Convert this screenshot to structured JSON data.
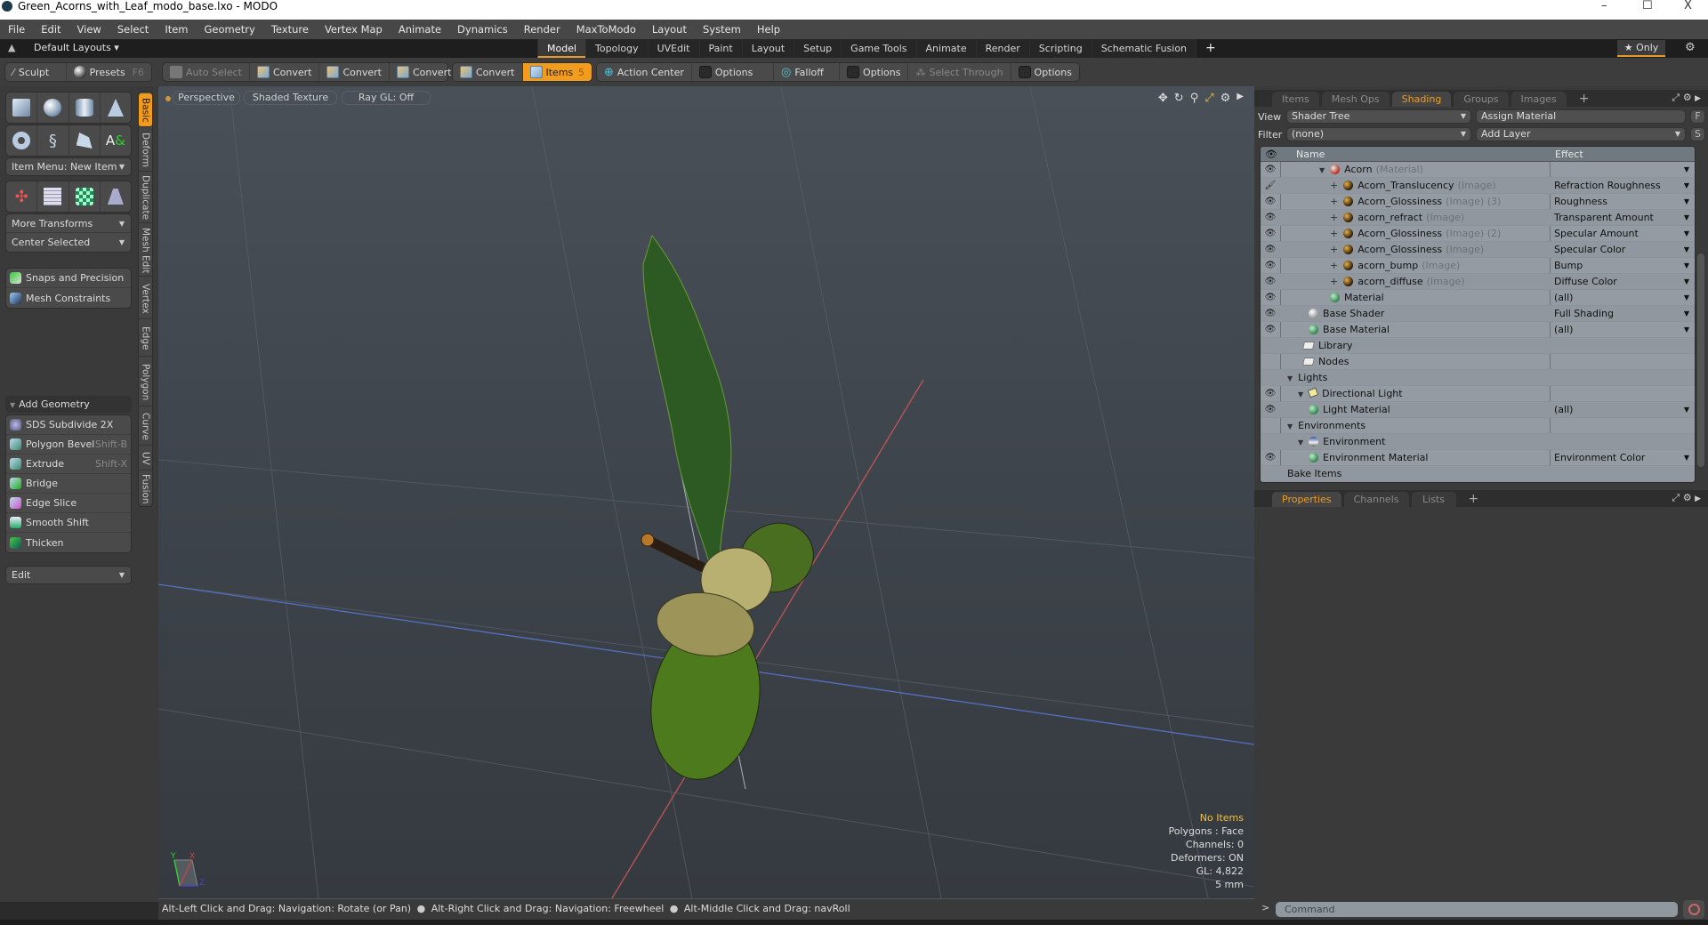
{
  "window": {
    "title": "Green_Acorns_with_Leaf_modo_base.lxo - MODO",
    "controls": [
      "–",
      "☐",
      "X"
    ]
  },
  "menu": [
    "File",
    "Edit",
    "View",
    "Select",
    "Item",
    "Geometry",
    "Texture",
    "Vertex Map",
    "Animate",
    "Dynamics",
    "Render",
    "MaxToModo",
    "Layout",
    "System",
    "Help"
  ],
  "layout_bar": {
    "layouts_label": "Default Layouts ▾",
    "tabs": [
      "Model",
      "Topology",
      "UVEdit",
      "Paint",
      "Layout",
      "Setup",
      "Game Tools",
      "Animate",
      "Render",
      "Scripting",
      "Schematic Fusion"
    ],
    "active_tab": "Model",
    "add_tab": "+",
    "only_label": "★ Only"
  },
  "toolbar": {
    "sculpt": "Sculpt",
    "presets": "Presets",
    "presets_hotkey": "F6",
    "auto_select": "Auto Select",
    "convert1": "Convert",
    "convert2": "Convert",
    "convert3": "Convert",
    "convert4": "Convert",
    "items": "Items",
    "items_count": "5",
    "action_center": "Action Center",
    "options1": "Options",
    "falloff": "Falloff",
    "options2": "Options",
    "select_through": "Select Through",
    "options3": "Options"
  },
  "left_panel": {
    "item_menu": "Item Menu: New Item",
    "more_transforms": "More Transforms",
    "center_selected": "Center Selected",
    "snaps": "Snaps and Precision",
    "mesh_constraints": "Mesh Constraints",
    "add_geometry": "Add Geometry",
    "tools": [
      {
        "label": "SDS Subdivide 2X",
        "hotkey": ""
      },
      {
        "label": "Polygon Bevel",
        "hotkey": "Shift-B"
      },
      {
        "label": "Extrude",
        "hotkey": "Shift-X"
      },
      {
        "label": "Bridge",
        "hotkey": ""
      },
      {
        "label": "Edge Slice",
        "hotkey": ""
      },
      {
        "label": "Smooth Shift",
        "hotkey": ""
      },
      {
        "label": "Thicken",
        "hotkey": ""
      }
    ],
    "edit_dropdown": "Edit",
    "vertical_tabs": [
      "Basic",
      "Deform",
      "Duplicate",
      "Mesh Edit",
      "Vertex",
      "Edge",
      "Polygon",
      "Curve",
      "UV",
      "Fusion"
    ],
    "active_vertical_tab": "Basic"
  },
  "viewport": {
    "view_mode": "Perspective",
    "shading": "Shaded Texture",
    "raygl": "Ray GL: Off",
    "stats": {
      "items": "No Items",
      "polygons": "Polygons : Face",
      "channels": "Channels: 0",
      "deformers": "Deformers: ON",
      "gl": "GL: 4,822",
      "grid": "5 mm"
    },
    "axis_labels": [
      "Y",
      "X",
      "Z"
    ]
  },
  "shading_panel": {
    "tabs": [
      "Items",
      "Mesh Ops",
      "Shading",
      "Groups",
      "Images"
    ],
    "active_tab": "Shading",
    "view_label": "View",
    "view_value": "Shader Tree",
    "assign_material": "Assign Material",
    "f_btn": "F",
    "filter_label": "Filter",
    "filter_value": "(none)",
    "add_layer": "Add Layer",
    "s_btn": "S",
    "col_name": "Name",
    "col_effect": "Effect",
    "rows": [
      {
        "name": "Acorn",
        "sub": "(Material)",
        "effect": "",
        "indent": 3,
        "icon": "acorn",
        "eye": "eye",
        "twisty": "▼",
        "dd": true
      },
      {
        "name": "Acorn_Translucency",
        "sub": "(Image)",
        "effect": "Refraction Roughness",
        "indent": 4,
        "icon": "img",
        "eye": "brush",
        "twisty": "+",
        "dd": true
      },
      {
        "name": "Acorn_Glossiness",
        "sub": "(Image) (3)",
        "effect": "Roughness",
        "indent": 4,
        "icon": "img",
        "eye": "eye",
        "twisty": "+",
        "dd": true
      },
      {
        "name": "acorn_refract",
        "sub": "(Image)",
        "effect": "Transparent Amount",
        "indent": 4,
        "icon": "img",
        "eye": "eye",
        "twisty": "+",
        "dd": true
      },
      {
        "name": "Acorn_Glossiness",
        "sub": "(Image) (2)",
        "effect": "Specular Amount",
        "indent": 4,
        "icon": "img",
        "eye": "eye",
        "twisty": "+",
        "dd": true
      },
      {
        "name": "Acorn_Glossiness",
        "sub": "(Image)",
        "effect": "Specular Color",
        "indent": 4,
        "icon": "img",
        "eye": "eye",
        "twisty": "+",
        "dd": true
      },
      {
        "name": "acorn_bump",
        "sub": "(Image)",
        "effect": "Bump",
        "indent": 4,
        "icon": "img",
        "eye": "eye",
        "twisty": "+",
        "dd": true
      },
      {
        "name": "acorn_diffuse",
        "sub": "(Image)",
        "effect": "Diffuse Color",
        "indent": 4,
        "icon": "img",
        "eye": "eye",
        "twisty": "+",
        "dd": true
      },
      {
        "name": "Material",
        "sub": "",
        "effect": "(all)",
        "indent": 4,
        "icon": "mat",
        "eye": "eye",
        "twisty": "",
        "dd": true
      },
      {
        "name": "Base Shader",
        "sub": "",
        "effect": "Full Shading",
        "indent": 2,
        "icon": "white",
        "eye": "eye",
        "twisty": "",
        "dd": true
      },
      {
        "name": "Base Material",
        "sub": "",
        "effect": "(all)",
        "indent": 2,
        "icon": "mat",
        "eye": "eye",
        "twisty": "",
        "dd": true
      },
      {
        "name": "Library",
        "sub": "",
        "effect": "",
        "indent": 1.5,
        "icon": "folder",
        "eye": "",
        "twisty": "",
        "dd": false
      },
      {
        "name": "Nodes",
        "sub": "",
        "effect": "",
        "indent": 1.5,
        "icon": "folder",
        "eye": "",
        "twisty": "",
        "dd": false
      },
      {
        "name": "Lights",
        "sub": "",
        "effect": "",
        "indent": 0,
        "icon": "",
        "eye": "",
        "twisty": "▼",
        "dd": false
      },
      {
        "name": "Directional Light",
        "sub": "",
        "effect": "",
        "indent": 1,
        "icon": "light",
        "eye": "eye",
        "twisty": "▼",
        "dd": false
      },
      {
        "name": "Light Material",
        "sub": "",
        "effect": "(all)",
        "indent": 2,
        "icon": "mat",
        "eye": "eye",
        "twisty": "",
        "dd": true
      },
      {
        "name": "Environments",
        "sub": "",
        "effect": "",
        "indent": 0,
        "icon": "",
        "eye": "",
        "twisty": "▼",
        "dd": false
      },
      {
        "name": "Environment",
        "sub": "",
        "effect": "",
        "indent": 1,
        "icon": "env",
        "eye": "",
        "twisty": "▼",
        "dd": false
      },
      {
        "name": "Environment Material",
        "sub": "",
        "effect": "Environment Color",
        "indent": 2,
        "icon": "mat",
        "eye": "eye",
        "twisty": "",
        "dd": true
      },
      {
        "name": "Bake Items",
        "sub": "",
        "effect": "",
        "indent": 0,
        "icon": "",
        "eye": "",
        "twisty": "",
        "dd": false
      }
    ]
  },
  "properties_panel": {
    "tabs": [
      "Properties",
      "Channels",
      "Lists"
    ],
    "active_tab": "Properties"
  },
  "status": {
    "hint1": "Alt-Left Click and Drag: Navigation: Rotate (or Pan)",
    "hint2": "Alt-Right Click and Drag: Navigation: Freewheel",
    "hint3": "Alt-Middle Click and Drag: navRoll",
    "separator": "●"
  },
  "command": {
    "prompt": ">",
    "placeholder": "Command"
  }
}
